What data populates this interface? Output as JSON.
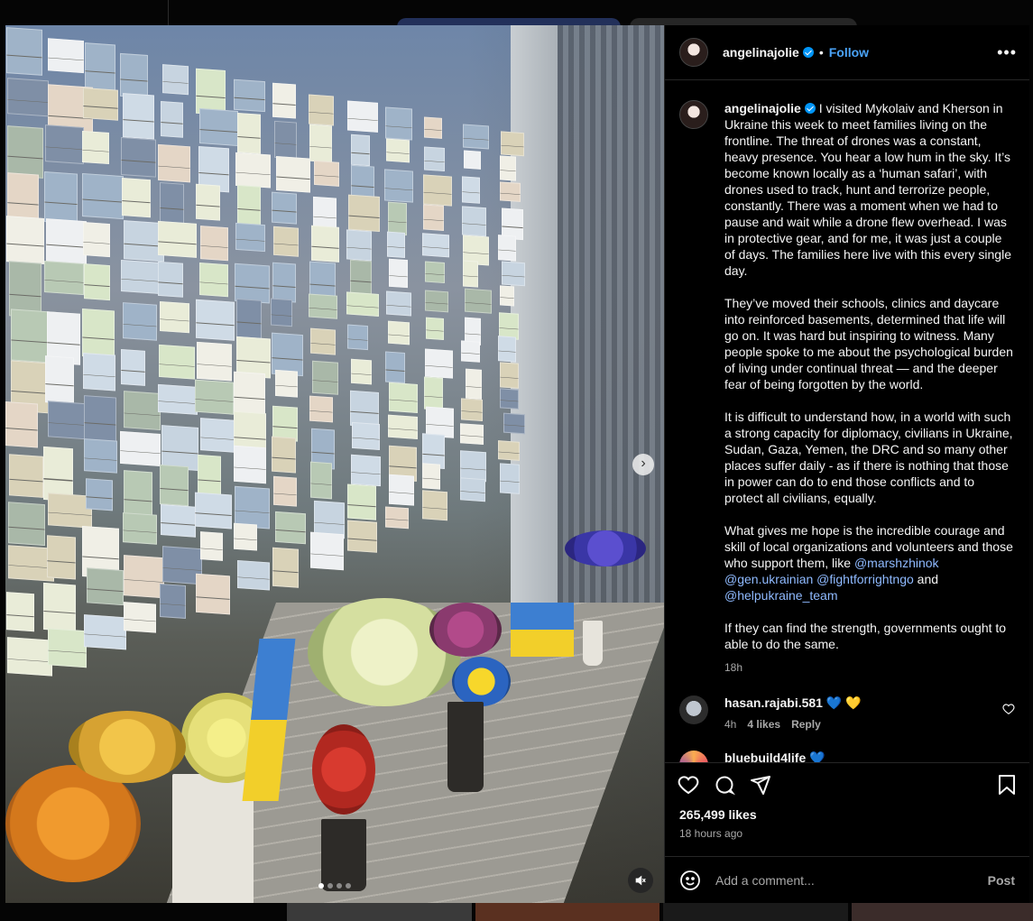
{
  "post": {
    "username": "angelinajolie",
    "follow_label": "Follow",
    "separator": "•",
    "more_label": "•••",
    "caption_paragraphs": [
      "I visited Mykolaiv and Kherson in Ukraine this week to meet families living on the frontline. The threat of drones was a constant, heavy presence. You hear a low hum in the sky. It’s become known locally as a ‘human safari’, with drones used to track, hunt and terrorize people, constantly. There was a moment when we had to pause and wait while a drone flew overhead. I was in protective gear, and for me, it was just a couple of days. The families here live with this every single day.",
      "They’ve moved their schools, clinics and daycare into reinforced basements, determined that life will go on. It was hard but inspiring to witness. Many people spoke to me about the psychological burden of living under continual threat — and the deeper fear of being forgotten by the world.",
      "It is difficult to understand how, in a world with such a strong capacity for diplomacy, civilians in Ukraine, Sudan, Gaza, Yemen, the DRC and so many other places suffer daily - as if there is nothing that those in power can do to end those conflicts and to protect all civilians, equally."
    ],
    "hope_text": "What gives me hope is the incredible courage and skill of local organizations and volunteers and those who support them, like",
    "mentions": [
      "@marshzhinok",
      "@gen.ukrainian",
      "@fightforrightngo",
      "@helpukraine_team"
    ],
    "and_word": "and",
    "closing_text": "If they can find the strength, governments ought to able to do the same.",
    "caption_time": "18h",
    "likes": "265,499 likes",
    "posted_ago": "18 hours ago",
    "comment_placeholder": "Add a comment...",
    "post_label": "Post"
  },
  "comments": [
    {
      "user": "hasan.rajabi.581",
      "text": "💙 💛",
      "time": "4h",
      "likes": "4 likes",
      "reply": "Reply"
    },
    {
      "user": "bluebuild4life",
      "text": "💙"
    }
  ],
  "media": {
    "slide_count": 4,
    "active_slide": 1,
    "next_icon": "chevron-right-icon",
    "mute_icon": "speaker-muted-icon"
  },
  "colors": {
    "accent": "#0095f6",
    "follow": "#4aa3f7",
    "mention": "#8fbaff",
    "panel_bg": "#000000",
    "muted_text": "#a8a8a8"
  }
}
